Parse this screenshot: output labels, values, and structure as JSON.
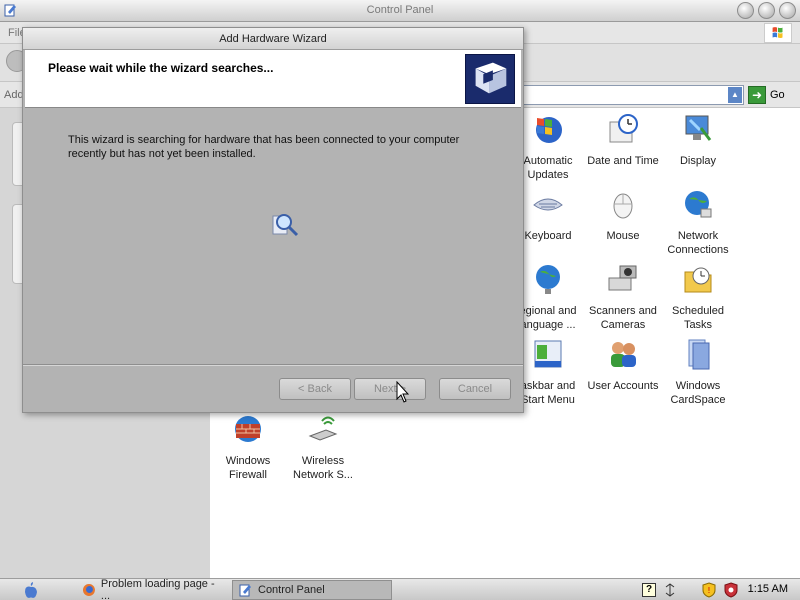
{
  "control_panel": {
    "title": "Control Panel",
    "menu_file": "File",
    "address_label": "Add",
    "go_label": "Go",
    "icons": [
      {
        "label": "Automatic Updates",
        "icon": "automatic-updates-icon"
      },
      {
        "label": "Date and Time",
        "icon": "date-time-icon"
      },
      {
        "label": "Display",
        "icon": "display-icon"
      },
      {
        "label": "Keyboard",
        "icon": "keyboard-icon"
      },
      {
        "label": "Mouse",
        "icon": "mouse-icon"
      },
      {
        "label": "Network Connections",
        "icon": "network-connections-icon"
      },
      {
        "label": "egional and anguage ...",
        "icon": "regional-language-icon"
      },
      {
        "label": "Scanners and Cameras",
        "icon": "scanners-cameras-icon"
      },
      {
        "label": "Scheduled Tasks",
        "icon": "scheduled-tasks-icon"
      },
      {
        "label": "askbar and Start Menu",
        "icon": "taskbar-start-menu-icon"
      },
      {
        "label": "User Accounts",
        "icon": "user-accounts-icon"
      },
      {
        "label": "Windows CardSpace",
        "icon": "windows-cardspace-icon"
      },
      {
        "label": "Windows Firewall",
        "icon": "windows-firewall-icon"
      },
      {
        "label": "Wireless Network S...",
        "icon": "wireless-network-icon"
      }
    ]
  },
  "wizard": {
    "title": "Add Hardware Wizard",
    "heading": "Please wait while the wizard searches...",
    "body_text": "This wizard is searching for hardware that has been connected to your computer recently but has not yet been installed.",
    "back_label": "< Back",
    "next_label": "Next >",
    "cancel_label": "Cancel"
  },
  "taskbar": {
    "tasks": [
      {
        "label": "Problem loading page - ...",
        "icon": "firefox-icon"
      },
      {
        "label": "Control Panel",
        "icon": "control-panel-icon",
        "active": true
      }
    ],
    "tray_help": "?",
    "clock": "1:15 AM"
  },
  "colors": {
    "wizard_header_icon_bg": "#1a2b6c",
    "go_button": "#3a9a3a",
    "address_dropdown": "#5c86c6"
  }
}
